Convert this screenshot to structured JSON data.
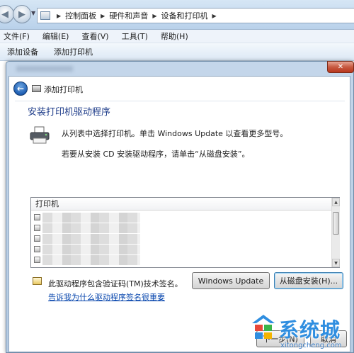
{
  "address_bar": {
    "breadcrumbs": [
      "控制面板",
      "硬件和声音",
      "设备和打印机"
    ]
  },
  "menu": {
    "items": [
      "文件(F)",
      "编辑(E)",
      "查看(V)",
      "工具(T)",
      "帮助(H)"
    ]
  },
  "command_bar": {
    "items": [
      "添加设备",
      "添加打印机"
    ]
  },
  "dialog": {
    "close_label": "✕",
    "wizard_title": "添加打印机",
    "heading": "安装打印机驱动程序",
    "instruction_1": "从列表中选择打印机。单击 Windows Update 以查看更多型号。",
    "instruction_2": "若要从安装 CD 安装驱动程序，请单击“从磁盘安装”。",
    "list_header": "打印机",
    "cert_text": "此驱动程序包含验证码(TM)技术签名。",
    "cert_link": "告诉我为什么驱动程序签名很重要",
    "windows_update_button": "Windows Update",
    "from_disk_button": "从磁盘安装(H)...",
    "next_button": "下一步(N)",
    "cancel_button": "取消"
  },
  "watermark": {
    "brand": "系统城",
    "url": "xitongcheng.com"
  },
  "colors": {
    "heading_blue": "#1f3d8a",
    "link_blue": "#0645ad",
    "dialog_frame": "#bcd0e6",
    "close_red": "#c75a41"
  }
}
